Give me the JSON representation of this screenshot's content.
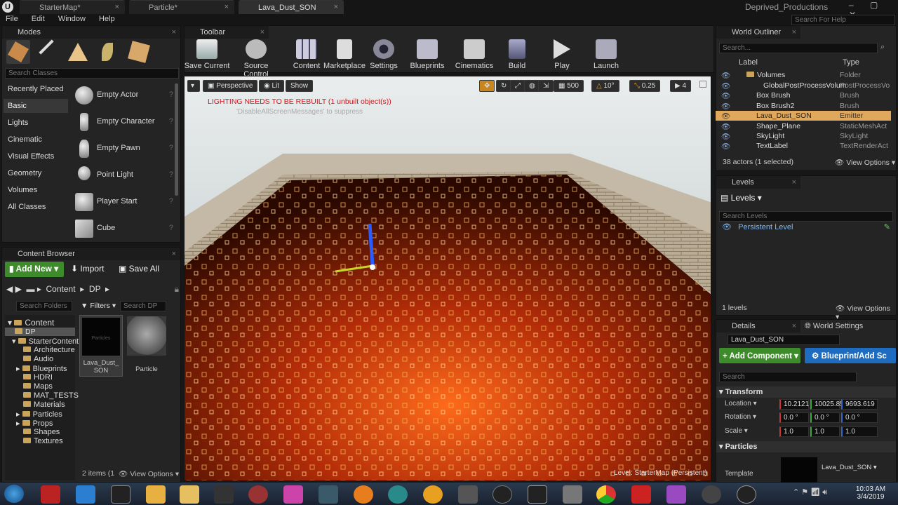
{
  "window": {
    "tabs": [
      "StarterMap*",
      "Particle*",
      "Lava_Dust_SON"
    ],
    "user": "Deprived_Productions",
    "help_search": "Search For Help"
  },
  "menu": [
    "File",
    "Edit",
    "Window",
    "Help"
  ],
  "modes": {
    "title": "Modes",
    "search": "Search Classes",
    "categories": [
      "Recently Placed",
      "Basic",
      "Lights",
      "Cinematic",
      "Visual Effects",
      "Geometry",
      "Volumes",
      "All Classes"
    ],
    "items": [
      "Empty Actor",
      "Empty Character",
      "Empty Pawn",
      "Point Light",
      "Player Start",
      "Cube"
    ]
  },
  "content_browser": {
    "title": "Content Browser",
    "add_new": "Add New",
    "import": "Import",
    "save_all": "Save All",
    "path": [
      "Content",
      "DP"
    ],
    "search_folders": "Search Folders",
    "filters": "Filters",
    "search_dp": "Search DP",
    "tree": [
      "Content",
      "DP",
      "StarterContent",
      "Architecture",
      "Audio",
      "Blueprints",
      "HDRI",
      "Maps",
      "MAT_TESTS",
      "Materials",
      "Particles",
      "Props",
      "Shapes",
      "Textures"
    ],
    "assets": [
      {
        "name": "Lava_Dust_\nSON",
        "thumb_text": "Particles"
      },
      {
        "name": "Particle"
      }
    ],
    "status": "2 items (1",
    "view_options": "View Options"
  },
  "toolbar": {
    "title": "Toolbar",
    "buttons": [
      "Save Current",
      "Source Control",
      "Content",
      "Marketplace",
      "Settings",
      "Blueprints",
      "Cinematics",
      "Build",
      "Play",
      "Launch"
    ]
  },
  "viewport": {
    "perspective": "Perspective",
    "lit": "Lit",
    "show": "Show",
    "grid": "500",
    "rot": "10°",
    "scale": "0.25",
    "cam": "4",
    "warning": "LIGHTING NEEDS TO BE REBUILT (1 unbuilt object(s))",
    "suppress": "'DisableAllScreenMessages' to suppress",
    "level": "Level:  StarterMap (Persistent)"
  },
  "outliner": {
    "title": "World Outliner",
    "search": "Search...",
    "col_label": "Label",
    "col_type": "Type",
    "rows": [
      {
        "label": "Volumes",
        "type": "Folder"
      },
      {
        "label": "GlobalPostProcessVolum",
        "type": "PostProcessVo"
      },
      {
        "label": "Box Brush",
        "type": "Brush"
      },
      {
        "label": "Box Brush2",
        "type": "Brush"
      },
      {
        "label": "Lava_Dust_SON",
        "type": "Emitter"
      },
      {
        "label": "Shape_Plane",
        "type": "StaticMeshAct"
      },
      {
        "label": "SkyLight",
        "type": "SkyLight"
      },
      {
        "label": "TextLabel",
        "type": "TextRenderAct"
      }
    ],
    "status": "38 actors (1 selected)",
    "view_options": "View Options"
  },
  "levels": {
    "title": "Levels",
    "header": "Levels",
    "search": "Search Levels",
    "item": "Persistent Level",
    "status": "1 levels",
    "view_options": "View Options"
  },
  "details": {
    "tab1": "Details",
    "tab2": "World Settings",
    "name": "Lava_Dust_SON",
    "add_component": "+ Add Component",
    "blueprint": "Blueprint/Add Sc",
    "search": "Search",
    "transform": "Transform",
    "location": "Location",
    "loc": [
      "10.2121",
      "10025.85",
      "9693.619"
    ],
    "rotation": "Rotation",
    "rot": [
      "0.0 °",
      "0.0 °",
      "0.0 °"
    ],
    "scale": "Scale",
    "scl": [
      "1.0",
      "1.0",
      "1.0"
    ],
    "particles": "Particles",
    "template": "Template",
    "template_val": "Lava_Dust_SON"
  },
  "taskbar": {
    "clock": "10:03 AM",
    "date": "3/4/2019"
  }
}
